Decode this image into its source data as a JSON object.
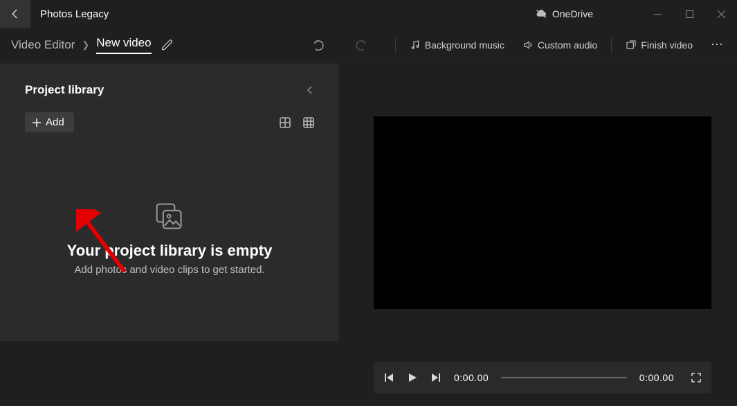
{
  "titlebar": {
    "app_name": "Photos Legacy",
    "onedrive_label": "OneDrive"
  },
  "breadcrumbs": {
    "root": "Video Editor",
    "current": "New video"
  },
  "toolbar": {
    "bg_music": "Background music",
    "custom_audio": "Custom audio",
    "finish": "Finish video"
  },
  "library": {
    "title": "Project library",
    "add_label": "Add",
    "empty_title": "Your project library is empty",
    "empty_sub": "Add photos and video clips to get started."
  },
  "player": {
    "time_current": "0:00.00",
    "time_total": "0:00.00"
  }
}
